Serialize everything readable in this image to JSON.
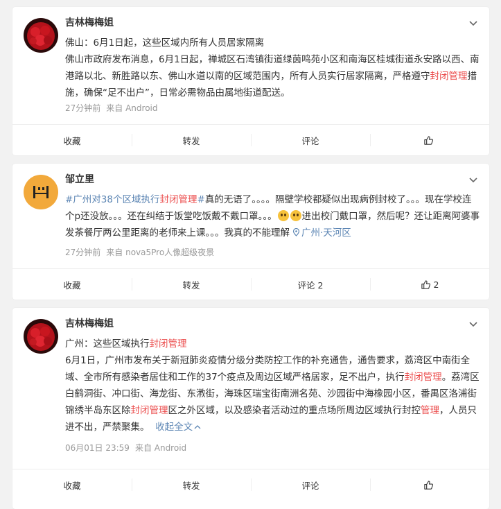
{
  "posts": [
    {
      "author": "吉林梅梅姐",
      "title": "佛山：6月1日起，这些区域内所有人员居家隔离",
      "body_part1": "佛山市政府发布消息，6月1日起，禅城区石湾镇街道绿茵鸣苑小区和南海区桂城街道永安路以西、南港路以北、新胜路以东、佛山水道以南的区域范围内，所有人员实行居家隔离，严格遵守",
      "body_red1": "封闭管理",
      "body_part2": "措施，确保“足不出户”，日常必需物品由属地街道配送。",
      "time": "27分钟前",
      "source": "来自 Android",
      "actions": {
        "collect": "收藏",
        "repost": "转发",
        "comment": "评论",
        "like": ""
      }
    },
    {
      "author": "邹立里",
      "topic_pre": "#广州对38个区域执行",
      "topic_red": "封闭管理",
      "topic_post": "#",
      "body_part1": "真的无语了。。。。隔壁学校都疑似出现病例封校了。。。现在学校连个p还没放。。。还在纠结于饭堂吃饭戴不戴口罩。。。",
      "body_part2": "进出校门戴口罩，然后呢？还让距离阿婆事发茶餐厅两公里距离的老师来上课。。。我真的不能理解",
      "location": "广州·天河区",
      "time": "27分钟前",
      "source": "来自 nova5Pro人像超级夜景",
      "actions": {
        "collect": "收藏",
        "repost": "转发",
        "comment": "评论 2",
        "like": "2"
      }
    },
    {
      "author": "吉林梅梅姐",
      "title_pre": "广州：这些区域执行",
      "title_red": "封闭管理",
      "body_part1": "6月1日，广州市发布关于新冠肺炎疫情分级分类防控工作的补充通告，通告要求，荔湾区中南街全域、全市所有感染者居住和工作的37个疫点及周边区域严格居家，足不出户，执行",
      "body_red1": "封闭管理",
      "body_part2": "。荔湾区白鹤洞街、冲口街、海龙街、东漖街，海珠区瑞宝街南洲名苑、沙园街中海橡园小区，番禺区洛浦街锦绣半岛东区除",
      "body_red2": "封闭管理",
      "body_part3": "区之外区域，以及感染者活动过的重点场所周边区域执行封控",
      "body_red3": "管理",
      "body_part4": "，人员只进不出，严禁聚集。",
      "collapse": "收起全文",
      "time": "06月01日 23:59",
      "source": "来自 Android",
      "actions": {
        "collect": "收藏",
        "repost": "转发",
        "comment": "评论",
        "like": ""
      }
    }
  ]
}
